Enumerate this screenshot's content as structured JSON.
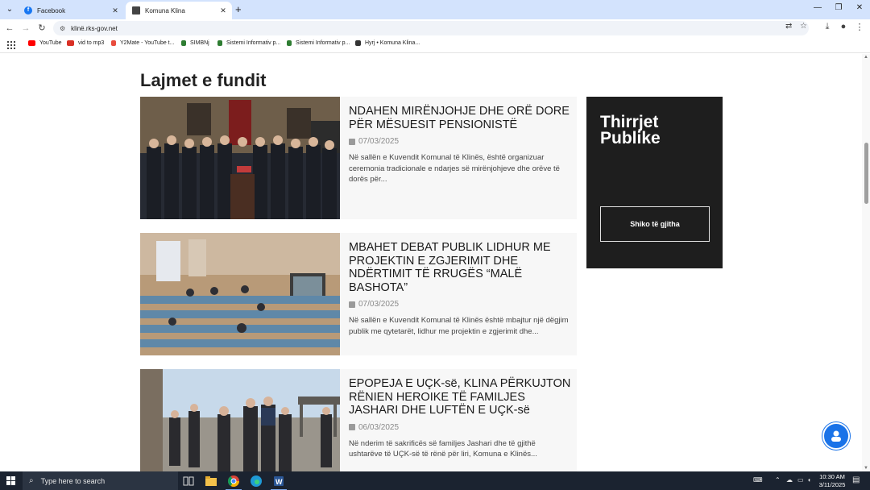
{
  "browser": {
    "tabs": [
      {
        "title": "Facebook",
        "icon": "facebook-icon",
        "active": false
      },
      {
        "title": "Komuna Klina",
        "icon": "komuna-klina-icon",
        "active": true
      }
    ],
    "url": "klinë.rks-gov.net",
    "bookmarks": [
      {
        "label": "YouTube",
        "icon": "youtube-icon",
        "color": "#ff0000"
      },
      {
        "label": "vid to mp3",
        "icon": "vid-to-mp3-icon",
        "color": "#d93025"
      },
      {
        "label": "Y2Mate - YouTube t...",
        "icon": "y2mate-icon",
        "color": "#e84c3d"
      },
      {
        "label": "SIMBNj",
        "icon": "simbnj-icon",
        "color": "#2e7d32"
      },
      {
        "label": "Sistemi Informativ p...",
        "icon": "sistemi-icon",
        "color": "#2e7d32"
      },
      {
        "label": "Sistemi Informativ p...",
        "icon": "sistemi-icon",
        "color": "#2e7d32"
      },
      {
        "label": "Hyrj • Komuna Klina...",
        "icon": "komuna-klina-icon",
        "color": "#333333"
      }
    ]
  },
  "page": {
    "section_title": "Lajmet e fundit",
    "news": [
      {
        "title": "NDAHEN MIRËNJOHJE DHE ORË DORE PËR MËSUESIT PENSIONISTË",
        "date": "07/03/2025",
        "excerpt": "Në sallën e Kuvendit Komunal të Klinës, është organizuar ceremonia tradicionale e ndarjes së mirënjohjeve dhe orëve të dorës për..."
      },
      {
        "title": "MBAHET DEBAT PUBLIK LIDHUR ME PROJEKTIN E ZGJERIMIT DHE NDËRTIMIT TË RRUGËS “MALË BASHOTA”",
        "date": "07/03/2025",
        "excerpt": "Në sallën e Kuvendit Komunal të Klinës është mbajtur një dëgjim publik me qytetarët, lidhur me projektin e zgjerimit dhe..."
      },
      {
        "title": "EPOPEJA E UÇK-së, KLINA PËRKUJTON RËNIEN HEROIKE TË FAMILJES JASHARI DHE LUFTËN E UÇK-së",
        "date": "06/03/2025",
        "excerpt": "Në nderim të sakrificës së familjes Jashari dhe të gjithë ushtarëve të UÇK-së të rënë për liri, Komuna e Klinës..."
      }
    ],
    "calls": {
      "title": "Thirrjet Publike",
      "button": "Shiko të gjitha"
    }
  },
  "taskbar": {
    "search_placeholder": "Type here to search",
    "time": "10:30 AM",
    "date": "3/11/2025"
  }
}
